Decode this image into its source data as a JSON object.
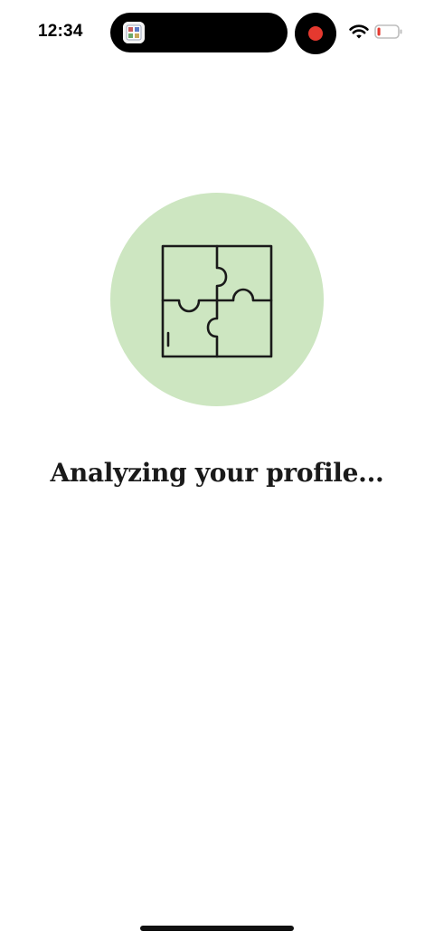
{
  "status_bar": {
    "time": "12:34",
    "icons": {
      "app_icon": "app-thumbnail-icon",
      "record": "screen-record-icon",
      "wifi": "wifi-icon",
      "battery": "battery-low-icon"
    },
    "colors": {
      "record_dot": "#e5392f",
      "battery_level": "#e5392f"
    },
    "battery_level": 0.15
  },
  "main": {
    "illustration": {
      "icon": "puzzle-icon",
      "background_color": "#cde6c1"
    },
    "heading": "Analyzing your profile..."
  }
}
